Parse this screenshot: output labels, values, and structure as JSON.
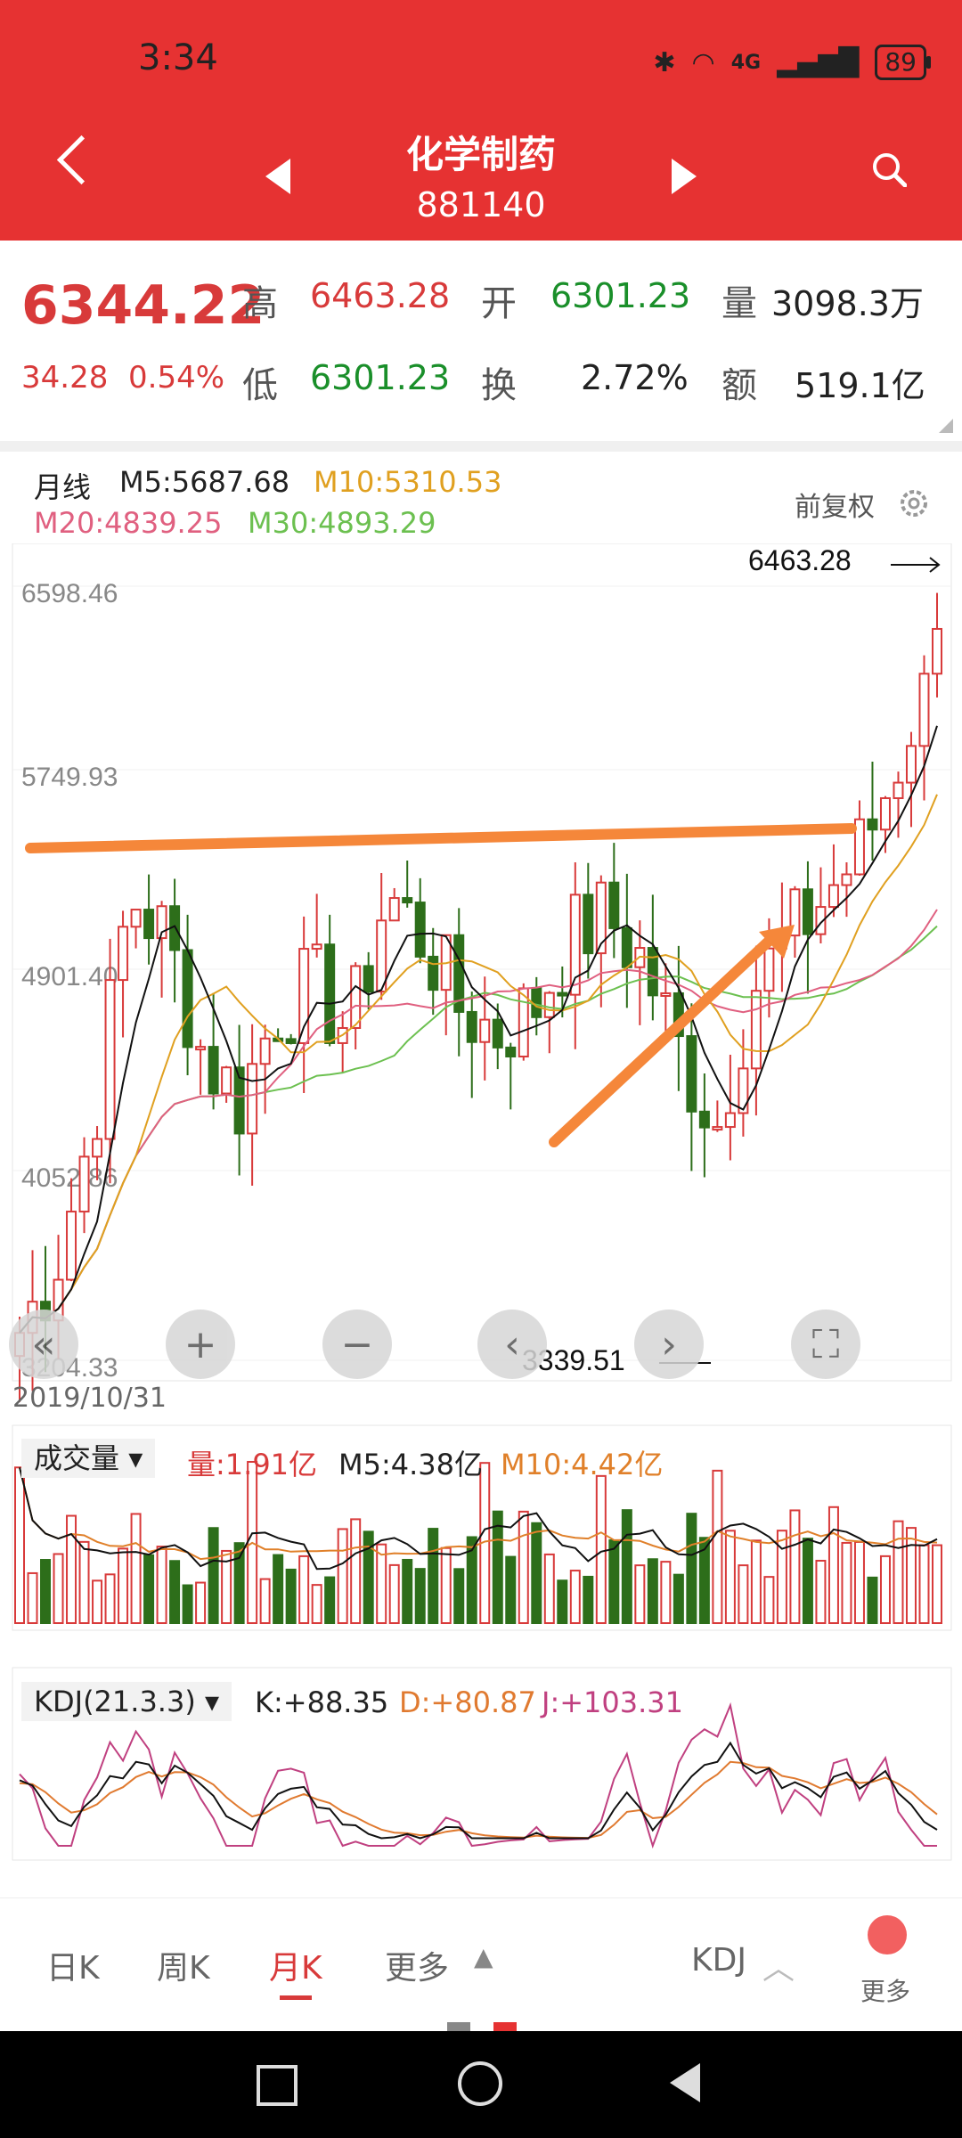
{
  "status": {
    "time": "3:34",
    "network": "4G",
    "battery": "89"
  },
  "header": {
    "name": "化学制药",
    "code": "881140"
  },
  "quote": {
    "price": "6344.22",
    "change": "34.28",
    "change_pct": "0.54%",
    "high_label": "高",
    "high": "6463.28",
    "open_label": "开",
    "open": "6301.23",
    "vol_label": "量",
    "vol": "3098.3万",
    "low_label": "低",
    "low": "6301.23",
    "turnover_label": "换",
    "turnover": "2.72%",
    "amount_label": "额",
    "amount": "519.1亿"
  },
  "legend": {
    "period": "月线",
    "m5": "M5:5687.68",
    "m10": "M10:5310.53",
    "m20": "M20:4839.25",
    "m30": "M30:4893.29",
    "adjust": "前复权"
  },
  "chart_data": {
    "type": "candlestick",
    "y_ticks": [
      "6598.46",
      "5749.93",
      "4901.40",
      "4052.86",
      "3204.33"
    ],
    "ylim": [
      3204.33,
      6598.46
    ],
    "max_label": "6463.28",
    "min_label": "3339.51",
    "start_date": "2019/10/31",
    "colors": {
      "up": "#d83a3a",
      "down": "#2d6e1a",
      "m5": "#111111",
      "m10": "#e0a020",
      "m20": "#e06080",
      "m30": "#6cc050",
      "annot": "#f5873a"
    }
  },
  "volume": {
    "label": "成交量",
    "vol": "量:1.91亿",
    "m5": "M5:4.38亿",
    "m10": "M10:4.42亿"
  },
  "kdj": {
    "label": "KDJ(21.3.3)",
    "k": "K:+88.35",
    "d": "D:+80.87",
    "j": "J:+103.31"
  },
  "tabs": {
    "day": "日K",
    "week": "周K",
    "month": "月K",
    "more": "更多",
    "indicator": "KDJ",
    "more2": "更多"
  }
}
